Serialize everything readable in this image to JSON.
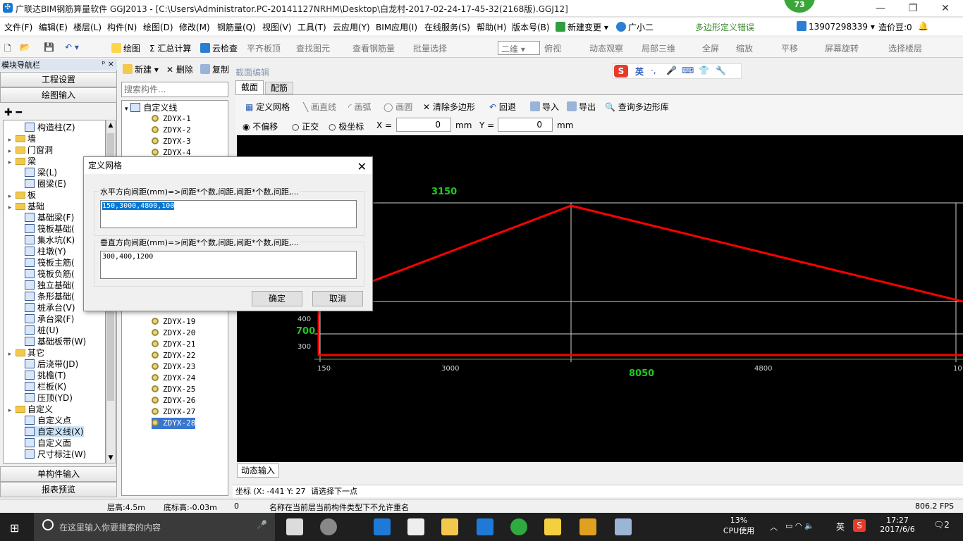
{
  "window": {
    "title": "广联达BIM钢筋算量软件 GGJ2013 - [C:\\Users\\Administrator.PC-20141127NRHM\\Desktop\\白龙村-2017-02-24-17-45-32(2168版).GGJ12]",
    "badge": "73",
    "app_icon": "✣"
  },
  "menubar": {
    "items": [
      "文件(F)",
      "编辑(E)",
      "楼层(L)",
      "构件(N)",
      "绘图(D)",
      "修改(M)",
      "钢筋量(Q)",
      "视图(V)",
      "工具(T)",
      "云应用(Y)",
      "BIM应用(I)",
      "在线服务(S)",
      "帮助(H)",
      "版本号(B)",
      "新建变更 ▾",
      "广小二"
    ],
    "error_text": "多边形定义错误",
    "phone": "13907298339",
    "phone_arrow": "▾",
    "coins": "造价豆:0"
  },
  "toolbar": {
    "items": [
      "绘图",
      "Σ 汇总计算",
      "云检查",
      "平齐板顶",
      "查找图元",
      "查看钢筋量",
      "批量选择",
      "二维",
      "俯视",
      "动态观察",
      "局部三维",
      "全屏",
      "缩放",
      "平移",
      "屏幕旋转",
      "选择楼层"
    ]
  },
  "nav": {
    "title": "模块导航栏",
    "pin": "ᵖ ×",
    "sections": [
      "工程设置",
      "绘图输入",
      "单构件输入",
      "报表预览"
    ],
    "tree": [
      {
        "label": "构造柱(Z)",
        "level": 2
      },
      {
        "label": "墙",
        "level": 0
      },
      {
        "label": "门窗洞",
        "level": 0
      },
      {
        "label": "梁",
        "level": 0
      },
      {
        "label": "梁(L)",
        "level": 1
      },
      {
        "label": "圈梁(E)",
        "level": 1
      },
      {
        "label": "板",
        "level": 0
      },
      {
        "label": "基础",
        "level": 0
      },
      {
        "label": "基础梁(F)",
        "level": 1
      },
      {
        "label": "筏板基础(",
        "level": 1
      },
      {
        "label": "集水坑(K)",
        "level": 1
      },
      {
        "label": "柱墩(Y)",
        "level": 1
      },
      {
        "label": "筏板主筋(",
        "level": 1
      },
      {
        "label": "筏板负筋(",
        "level": 1
      },
      {
        "label": "独立基础(",
        "level": 1
      },
      {
        "label": "条形基础(",
        "level": 1
      },
      {
        "label": "桩承台(V)",
        "level": 1
      },
      {
        "label": "承台梁(F)",
        "level": 1
      },
      {
        "label": "桩(U)",
        "level": 1
      },
      {
        "label": "基础板带(W)",
        "level": 1
      },
      {
        "label": "其它",
        "level": 0
      },
      {
        "label": "后浇带(JD)",
        "level": 1
      },
      {
        "label": "挑檐(T)",
        "level": 1
      },
      {
        "label": "栏板(K)",
        "level": 1
      },
      {
        "label": "压顶(YD)",
        "level": 1
      },
      {
        "label": "自定义",
        "level": 0
      },
      {
        "label": "自定义点",
        "level": 1
      },
      {
        "label": "自定义线(X)",
        "level": 1
      },
      {
        "label": "自定义面",
        "level": 1
      },
      {
        "label": "尺寸标注(W)",
        "level": 1
      }
    ]
  },
  "components": {
    "toolbar": [
      "新建 ▾",
      "删除",
      "复制"
    ],
    "search_placeholder": "搜索构件...",
    "root": "自定义线",
    "items_top": [
      "ZDYX-1",
      "ZDYX-2",
      "ZDYX-3",
      "ZDYX-4"
    ],
    "items_bottom": [
      "ZDYX-19",
      "ZDYX-20",
      "ZDYX-21",
      "ZDYX-22",
      "ZDYX-23",
      "ZDYX-24",
      "ZDYX-25",
      "ZDYX-26",
      "ZDYX-27",
      "ZDYX-28"
    ]
  },
  "editor": {
    "title": "截面编辑",
    "tabs": [
      "截面",
      "配筋"
    ],
    "tools": [
      "定义网格",
      "画直线",
      "画弧",
      "画圆",
      "清除多边形",
      "回退",
      "导入",
      "导出",
      "查询多边形库"
    ],
    "snap": [
      "不偏移",
      "正交",
      "极坐标"
    ],
    "x_label": "X =",
    "x_value": "0",
    "y_label": "Y =",
    "y_value": "0",
    "unit": "mm",
    "dynamic_input": "动态输入",
    "coord_label": "坐标 (X: -441 Y: 27",
    "prompt": "请选择下一点",
    "dims": {
      "top": "3150",
      "bottom": "8050",
      "left": "700",
      "h_ticks": [
        "150",
        "3000",
        "4800",
        "10"
      ],
      "v_ticks": [
        "400",
        "300"
      ]
    }
  },
  "ime": {
    "items": [
      "英",
      "·,",
      "🎤",
      "⌨",
      "👕",
      "🔧"
    ]
  },
  "dialog": {
    "title": "定义网格",
    "h_label": "水平方向间距(mm)=>间距*个数,间距,间距*个数,间距,...",
    "h_value": "150,3000,4800,100",
    "v_label": "垂直方向间距(mm)=>间距*个数,间距,间距*个数,间距,...",
    "v_value": "300,400,1200",
    "ok": "确定",
    "cancel": "取消"
  },
  "status": {
    "floor_height": "层高:4.5m",
    "base_height": "底标高:-0.03m",
    "count": "0",
    "message": "名称在当前层当前构件类型下不允许重名",
    "fps": "806.2 FPS"
  },
  "taskbar": {
    "search": "在这里输入你要搜索的内容",
    "cpu": "13%",
    "cpu_label": "CPU使用",
    "time": "17:27",
    "date": "2017/6/6",
    "ime": "英",
    "notif": "2"
  },
  "colors": {
    "canvas": "#000000",
    "polyline": "#ff0000",
    "dim_text": "#1ec81e"
  }
}
